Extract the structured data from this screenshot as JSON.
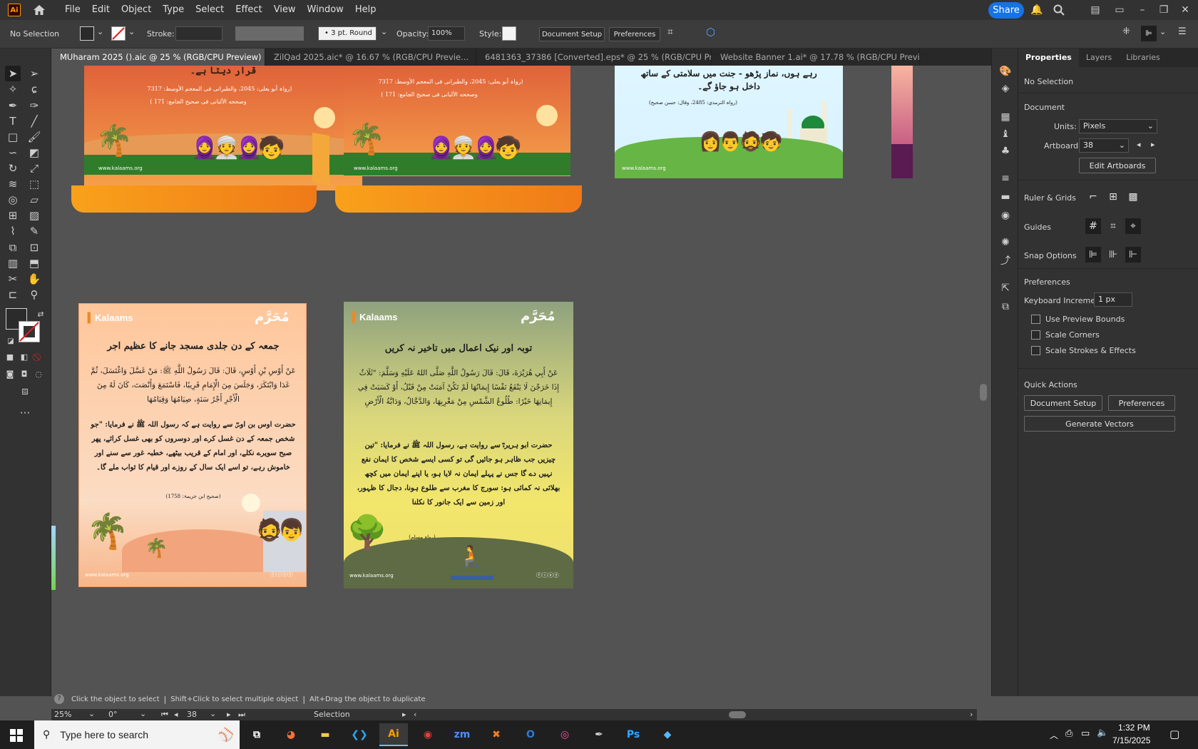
{
  "app": {
    "logo": "Ai",
    "menu": [
      "File",
      "Edit",
      "Object",
      "Type",
      "Select",
      "Effect",
      "View",
      "Window",
      "Help"
    ],
    "share_label": "Share"
  },
  "control_bar": {
    "selection": "No Selection",
    "stroke_label": "Stroke:",
    "brush_value": "3 pt. Round",
    "opacity_label": "Opacity:",
    "opacity_value": "100%",
    "style_label": "Style:",
    "document_setup": "Document Setup",
    "preferences": "Preferences"
  },
  "tabs": [
    {
      "label": "MUharam 2025 ().aic @ 25 % (RGB/CPU Preview)",
      "active": true
    },
    {
      "label": "ZilQad 2025.aic* @ 16.67 % (RGB/CPU Previe...",
      "active": false
    },
    {
      "label": "6481363_37386 [Converted].eps* @ 25 % (RGB/CPU Previe...",
      "active": false
    },
    {
      "label": "Website Banner 1.ai* @ 17.78 % (RGB/CPU Previe...",
      "active": false
    }
  ],
  "artboards": {
    "top1": {
      "heading": "قرار دیتا ہے۔",
      "reference1": "(رواہ أبو یعلی: 2045، والطبرانی فی المعجم الأوسط: 7317",
      "reference2": "وصححه الألبانی فی صحیح الجامع: 171 )",
      "website": "www.kalaams.org"
    },
    "top2": {
      "reference1": "(رواہ أبو یعلی: 2045، والطبرانی فی المعجم الأوسط: 7317",
      "reference2": "وصححه الألبانی فی صحیح الجامع: 171 )",
      "website": "www.kalaams.org"
    },
    "top3": {
      "heading_line1": "رہے ہوں، نماز پڑھو - جنت میں سلامتی کے ساتھ",
      "heading_line2": "داخل ہو جاؤ گے۔",
      "reference": "(رواہ الترمذي: 2485، وقال: حسن صحیح)",
      "website": "www.kalaams.org"
    },
    "bottom1": {
      "brand": "Kalaams",
      "badge": "مُحَرَّم",
      "title": "جمعہ کے دن جلدی مسجد جانے کا عظیم اجر",
      "arabic": "عَنْ أَوْسِ بْنِ أَوْسٍ، قَالَ: قَالَ رَسُولُ اللَّهِ ﷺ: مَنْ غَسَّلَ وَاغْتَسَلَ، ثُمَّ غَدَا وَابْتَكَرَ، وَجَلَسَ مِنَ الْإِمَامِ قَرِيبًا، فَاسْتَمَعَ وَأَنْصَتَ، كَانَ لَهُ مِنَ الْأَجْرِ أَجْرُ سَنَةٍ، صِيَامُهَا وَقِيَامُهَا",
      "urdu": "حضرت اوس بن اوسؓ سے روایت ہے کہ رسول اللہ ﷺ نے فرمایا: \"جو شخص جمعہ کے دن غسل کرے اور دوسروں کو بھی غسل کرائے، پھر صبح سویرے نکلے، اور امام کے قریب بیٹھے، خطبہ غور سے سنے اور خاموش رہے، تو اسے ایک سال کے روزے اور قیام کا ثواب ملے گا۔",
      "reference": "(صحیح ابن خزیمۃ: 1758)",
      "website": "www.kalaams.org"
    },
    "bottom2": {
      "brand": "Kalaams",
      "badge": "مُحَرَّم",
      "title": "توبہ اور نیک اعمال میں تاخیر نہ کریں",
      "arabic": "عَنْ أَبِي هُرَيْرَةَ، قَالَ: قَالَ رَسُولُ اللَّهِ صَلَّى اللهُ عَلَيْهِ وَسَلَّمَ: \"ثَلَاثٌ إِذَا خَرَجْنَ لَا يَنْفَعُ نَفْسًا إِيمَانُهَا لَمْ تَكُنْ آمَنَتْ مِنْ قَبْلُ، أَوْ كَسَبَتْ فِي إِيمَانِهَا خَيْرًا: طُلُوعُ الشَّمْسِ مِنْ مَغْرِبِهَا، وَالدَّجَّالُ، وَدَابَّةُ الْأَرْضِ",
      "urdu": "حضرت ابو ہریرہؓ سے روایت ہے، رسول اللہ ﷺ نے فرمایا: \"تین چیزیں جب ظاہر ہو جائیں گی تو کسی ایسے شخص کا ایمان نفع نہیں دے گا جس نے پہلے ایمان نہ لایا ہو، یا اپنے ایمان میں کچھ بھلائی نہ کمائی ہو: سورج کا مغرب سے طلوع ہونا، دجال کا ظہور، اور زمین سے ایک جانور کا نکلنا",
      "reference": "(رواہ مسلم)",
      "website": "www.kalaams.org"
    }
  },
  "panel": {
    "tabs": [
      "Properties",
      "Layers",
      "Libraries"
    ],
    "selection": "No Selection",
    "document_heading": "Document",
    "units_label": "Units:",
    "units_value": "Pixels",
    "artboard_label": "Artboard:",
    "artboard_value": "38",
    "edit_artboards": "Edit Artboards",
    "ruler_grids": "Ruler & Grids",
    "guides": "Guides",
    "snap_options": "Snap Options",
    "preferences_heading": "Preferences",
    "keyboard_increment_label": "Keyboard Increment:",
    "keyboard_increment_value": "1 px",
    "use_preview_bounds": "Use Preview Bounds",
    "scale_corners": "Scale Corners",
    "scale_strokes": "Scale Strokes & Effects",
    "quick_actions": "Quick Actions",
    "document_setup": "Document Setup",
    "preferences": "Preferences",
    "generate_vectors": "Generate Vectors"
  },
  "status": {
    "hint1": "Click the object to select",
    "hint2": "Shift+Click to select multiple object",
    "hint3": "Alt+Drag the object to duplicate",
    "zoom": "25%",
    "rotation": "0°",
    "artboard_nav": "38",
    "tool_name": "Selection"
  },
  "taskbar": {
    "search_placeholder": "Type here to search",
    "time": "1:32 PM",
    "date": "7/15/2025"
  },
  "colors": {
    "accent": "#1473e6",
    "ui_dark": "#323232",
    "canvas": "#535353"
  }
}
